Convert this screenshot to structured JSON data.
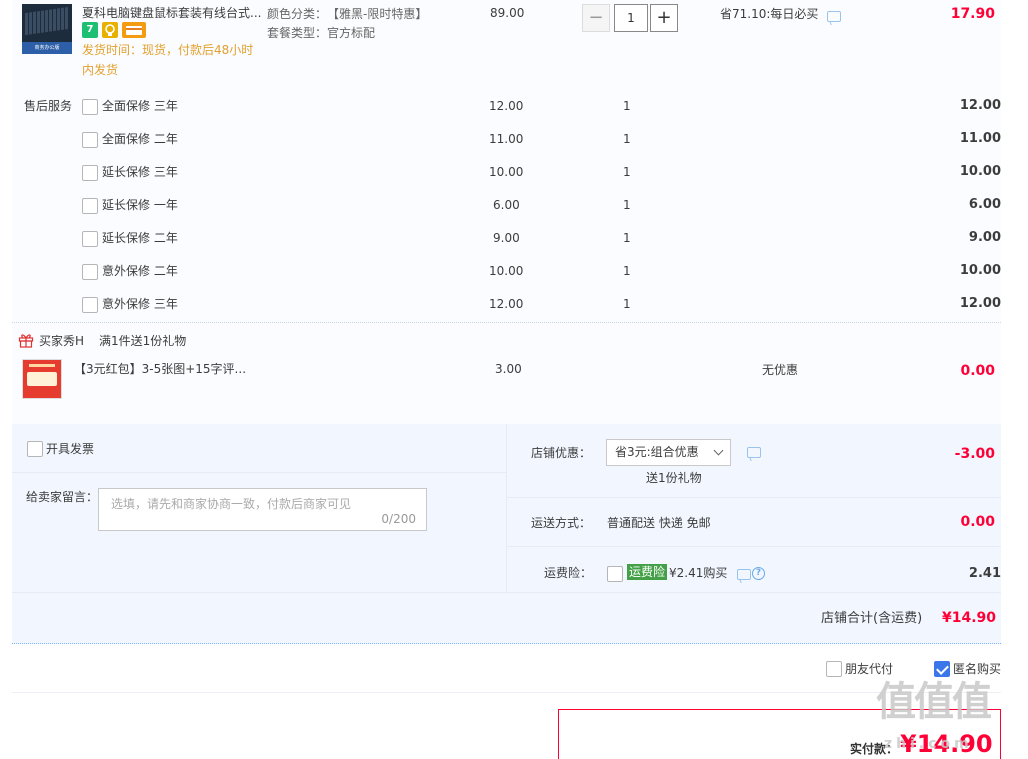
{
  "product": {
    "title": "夏科电脑键盘鼠标套装有线台式...",
    "ship_time": "发货时间：现货，付款后48小时内发货",
    "ship_line1": "发货时间：现货，付款后48小时",
    "ship_line2": "内发货",
    "attr_color_label": "颜色分类：",
    "attr_color_value": "【雅黑-限时特惠】",
    "attr_pkg_label": "套餐类型：",
    "attr_pkg_value": "官方标配",
    "price": "89.00",
    "quantity": "1",
    "promo": "省71.10:每日必买",
    "subtotal": "17.90",
    "thumb_band_text": "商务办公版",
    "badge_seven": "7"
  },
  "after_sales": {
    "label": "售后服务",
    "items": [
      {
        "name": "全面保修 三年",
        "price": "12.00",
        "qty": "1",
        "sum": "12.00"
      },
      {
        "name": "全面保修 二年",
        "price": "11.00",
        "qty": "1",
        "sum": "11.00"
      },
      {
        "name": "延长保修 三年",
        "price": "10.00",
        "qty": "1",
        "sum": "10.00"
      },
      {
        "name": "延长保修 一年",
        "price": "6.00",
        "qty": "1",
        "sum": "6.00"
      },
      {
        "name": "延长保修 二年",
        "price": "9.00",
        "qty": "1",
        "sum": "9.00"
      },
      {
        "name": "意外保修 二年",
        "price": "10.00",
        "qty": "1",
        "sum": "10.00"
      },
      {
        "name": "意外保修 三年",
        "price": "12.00",
        "qty": "1",
        "sum": "12.00"
      }
    ]
  },
  "gift": {
    "shop": "买家秀H",
    "rule": "满1件送1份礼物",
    "item_title": "【3元红包】3-5张图+15字评...",
    "price": "3.00",
    "promo": "无优惠",
    "subtotal": "0.00"
  },
  "options": {
    "invoice_label": "开具发票",
    "message_label": "给卖家留言：",
    "message_placeholder": "选填，请先和商家协商一致，付款后商家可见",
    "message_count": "0/200",
    "shop_discount_label": "店铺优惠：",
    "shop_discount_value": "省3元:组合优惠",
    "shop_discount_gift": "送1份礼物",
    "shop_discount_amount": "-3.00",
    "delivery_label": "运送方式：",
    "delivery_value": "普通配送 快递 免邮",
    "delivery_amount": "0.00",
    "insurance_label": "运费险：",
    "insurance_tag": "运费险",
    "insurance_price": "¥2.41购买",
    "insurance_amount": "2.41",
    "shop_total_label": "店铺合计(含运费)",
    "shop_total_value": "¥14.90"
  },
  "footer": {
    "friend_pay_label": "朋友代付",
    "anonymous_label": "匿名购买",
    "final_label": "实付款：",
    "final_value": "¥14.90"
  },
  "watermark": {
    "text": "值值值",
    "url": "zhi.com"
  },
  "colors": {
    "accent_red": "#ff0036",
    "orange": "#e2a12d",
    "blue_check": "#3c77ea",
    "insurance_green": "#43a047"
  },
  "icons": [
    "message-icon",
    "question-icon",
    "gift-icon",
    "chevron-down-icon",
    "checkmark-icon"
  ]
}
